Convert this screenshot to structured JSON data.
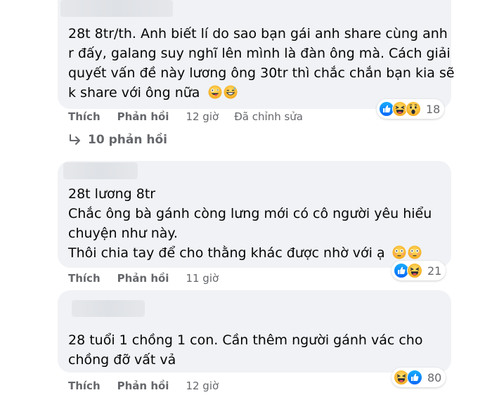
{
  "comments": [
    {
      "lines": [
        "28t 8tr/th. Anh biết lí do sao bạn gái anh share cùng anh",
        "r đấy, galang suy nghĩ lên mình là đàn ông mà. Cách giải",
        "quyết vấn đề này lương ông 30tr thì chắc chắn bạn kia sẽ",
        "k share với ông nữa"
      ],
      "trailing_emojis": [
        "zany-face-icon",
        "grinning-sweat-face-icon"
      ],
      "actions": {
        "like": "Thích",
        "reply": "Phản hồi",
        "time": "12 giờ",
        "edited": "Đã chỉnh sửa"
      },
      "reactions": {
        "icons": [
          "like-icon",
          "haha-icon",
          "wow-icon"
        ],
        "count": "18"
      },
      "replies_label": "10 phản hồi"
    },
    {
      "lines": [
        "28t lương 8tr",
        "Chắc ông bà gánh còng lưng mới có cô người yêu hiểu",
        "chuyện như này.",
        "Thôi chia tay để cho thằng khác được nhờ với ạ"
      ],
      "trailing_emojis": [
        "flushed-face-icon",
        "flushed-face-icon"
      ],
      "actions": {
        "like": "Thích",
        "reply": "Phản hồi",
        "time": "11 giờ"
      },
      "reactions": {
        "icons": [
          "like-icon",
          "haha-icon"
        ],
        "count": "21"
      }
    },
    {
      "lines": [
        "28 tuổi 1 chồng 1 con. Cần thêm người gánh vác cho",
        "chồng đỡ vất vả"
      ],
      "actions": {
        "like": "Thích",
        "reply": "Phản hồi",
        "time": "12 giờ"
      },
      "reactions": {
        "icons": [
          "haha-icon",
          "like-icon"
        ],
        "count": "80"
      }
    }
  ],
  "colors": {
    "bubble": "#f0f2f5",
    "meta": "#65676b",
    "like_blue": "#1877f2",
    "haha_yellow": "#f7b125"
  }
}
